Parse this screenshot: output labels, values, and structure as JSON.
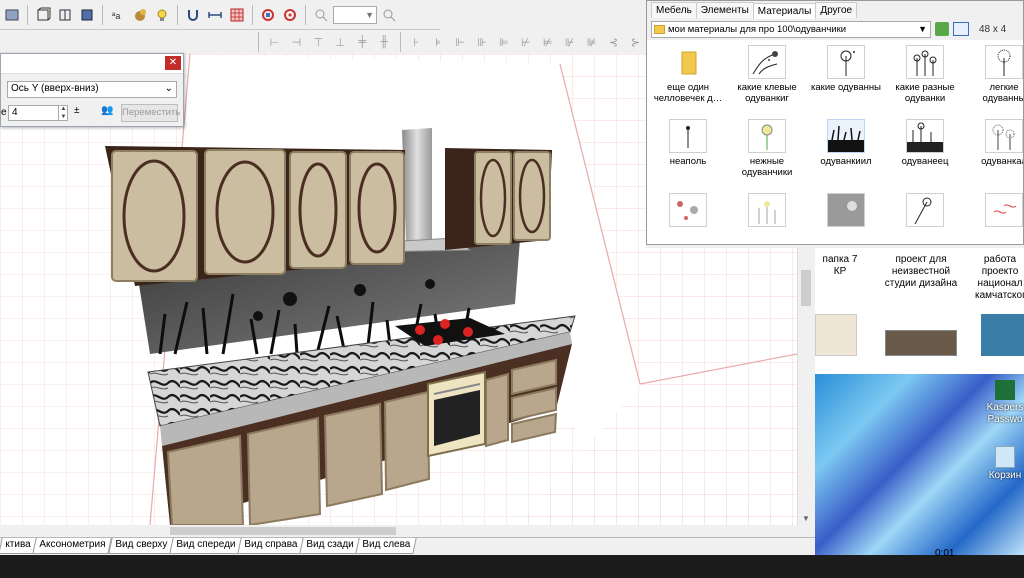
{
  "toolbar": {
    "icons": [
      "select-icon",
      "box-icon",
      "door-icon",
      "panel-icon",
      "texture-icon",
      "rotate-icon",
      "lamp-icon",
      "magnet-icon",
      "dimension-icon",
      "grid-icon",
      "measure-icon",
      "target-icon",
      "zoom-out-icon",
      "zoom-in-icon"
    ],
    "zoom_value": ""
  },
  "align_toolbar": {
    "icons": [
      "align-left-icon",
      "align-center-icon",
      "align-right-icon",
      "align-top-icon",
      "align-middle-icon",
      "align-bottom-icon",
      "distribute-h-icon",
      "distribute-v-icon",
      "align-a-icon",
      "align-b-icon",
      "align-c-icon",
      "align-d-icon",
      "align-e-icon",
      "align-f-icon",
      "align-g-icon",
      "align-h-icon",
      "align-i-icon",
      "align-j-icon"
    ]
  },
  "move_panel": {
    "axis_value": "Ось Y (вверх-вниз)",
    "distance_label": "е",
    "distance_value": "4",
    "move_button": "Переместить"
  },
  "view_tabs": [
    "ктива",
    "Аксонометрия",
    "Вид сверху",
    "Вид спереди",
    "Вид справа",
    "Вид сзади",
    "Вид слева"
  ],
  "library": {
    "tabs": [
      "Мебель",
      "Элементы",
      "Материалы",
      "Другое"
    ],
    "active_tab": "Материалы",
    "path": "мои материалы для про 100\\одуванчики",
    "size_value": "48 x 4",
    "items": [
      {
        "label": "еще один челловечек д…",
        "kind": "folder"
      },
      {
        "label": "какие клевые одуванкиг",
        "kind": "thumb"
      },
      {
        "label": "какие одуванны",
        "kind": "thumb"
      },
      {
        "label": "какие разные одуванки",
        "kind": "thumb"
      },
      {
        "label": "легкие одуванны",
        "kind": "thumb"
      },
      {
        "label": "неаполь",
        "kind": "thumb"
      },
      {
        "label": "нежные одуванчики",
        "kind": "thumb"
      },
      {
        "label": "одуванкиил",
        "kind": "thumb"
      },
      {
        "label": "одуванеец",
        "kind": "thumb"
      },
      {
        "label": "одуванкаа",
        "kind": "thumb"
      },
      {
        "label": "",
        "kind": "thumb"
      },
      {
        "label": "",
        "kind": "thumb"
      },
      {
        "label": "",
        "kind": "thumb"
      },
      {
        "label": "",
        "kind": "thumb"
      },
      {
        "label": "",
        "kind": "thumb"
      }
    ]
  },
  "background_files": [
    {
      "label": "папка 7 КР"
    },
    {
      "label": "проект для неизвестной студии дизайна"
    },
    {
      "label": "работа проекто национал камчатског"
    }
  ],
  "desktop_icons": [
    {
      "label": "Kaspers Passwo"
    },
    {
      "label": "Корзин"
    }
  ],
  "clock": "0:01",
  "colors": {
    "close_red": "#c42b2b",
    "grid_pink": "#f2c9c9",
    "cabinet_beige": "#b8a78c",
    "wood_dark": "#4a2e22"
  }
}
